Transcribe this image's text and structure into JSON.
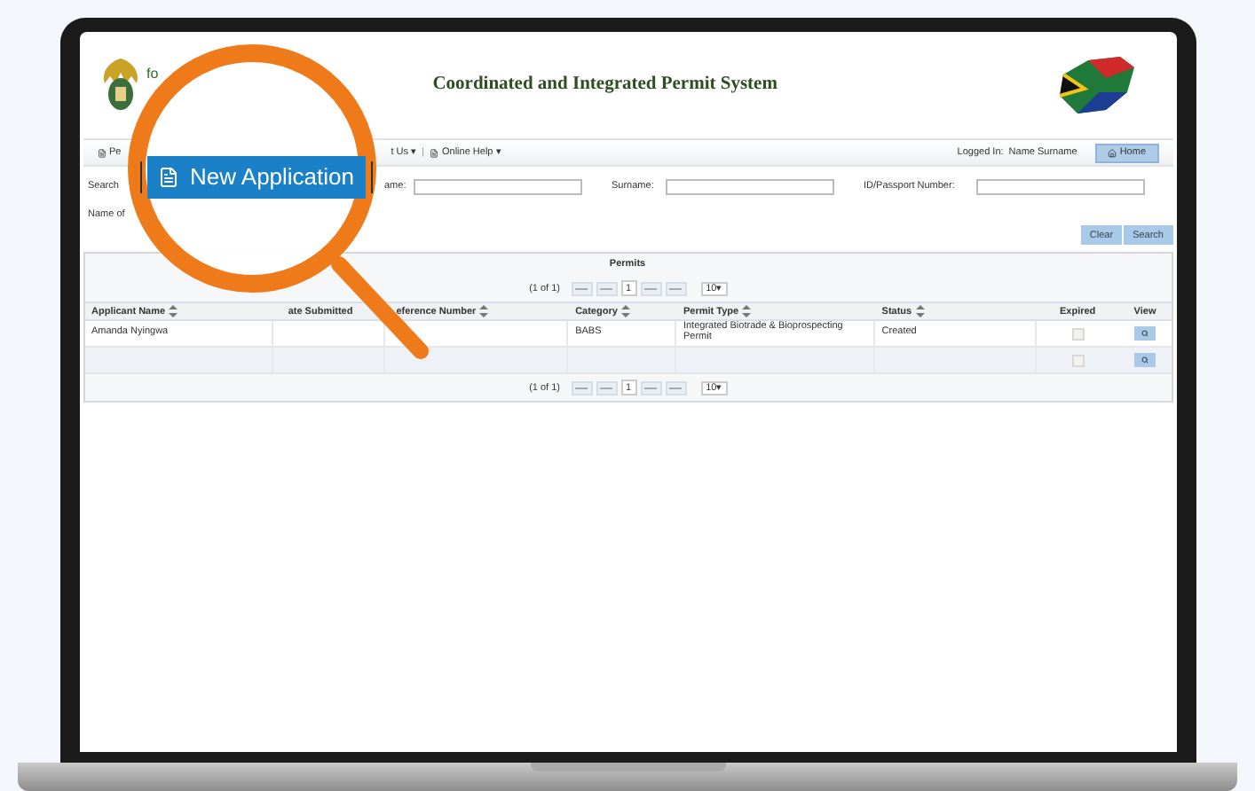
{
  "header": {
    "logo_text": "fo",
    "title": "Coordinated and Integrated Permit System"
  },
  "menu": {
    "items": [
      {
        "label": "Pe",
        "icon": true
      },
      {
        "label": "t Us ▾",
        "icon": false
      },
      {
        "label": "Online Help ▾",
        "icon": true
      }
    ],
    "separator": "|",
    "logged_in_label": "Logged In:",
    "user": "Name Surname",
    "home": "Home"
  },
  "search": {
    "label": "Search",
    "fields": [
      {
        "label": "ame:"
      },
      {
        "label": "Surname:"
      },
      {
        "label": "ID/Passport Number:"
      }
    ],
    "name_of": "Name of",
    "buttons": [
      "Clear",
      "Search"
    ]
  },
  "table": {
    "title": "Permits",
    "pagers": [
      {
        "page_info": "(1 of 1)",
        "page": "1",
        "per_page": "10▾"
      },
      {
        "page_info": "(1 of 1)",
        "page": "1",
        "per_page": "10▾"
      }
    ],
    "columns": [
      {
        "label": "Applicant Name",
        "sortable": true
      },
      {
        "label": "ate Submitted",
        "sortable": false
      },
      {
        "label": "eference Number",
        "sortable": true
      },
      {
        "label": "Category",
        "sortable": true
      },
      {
        "label": "Permit Type",
        "sortable": true
      },
      {
        "label": "Status",
        "sortable": true
      },
      {
        "label": "Expired",
        "sortable": false
      },
      {
        "label": "View",
        "sortable": false
      }
    ],
    "rows": [
      {
        "cells": [
          "Amanda Nyingwa",
          "",
          "",
          "BABS",
          "Integrated Biotrade & Bioprospecting Permit",
          "Created"
        ],
        "expired": false
      },
      {
        "cells": [
          "",
          "",
          "",
          "",
          "",
          ""
        ],
        "expired": false
      }
    ]
  },
  "magnifier": {
    "button": "New Application"
  }
}
